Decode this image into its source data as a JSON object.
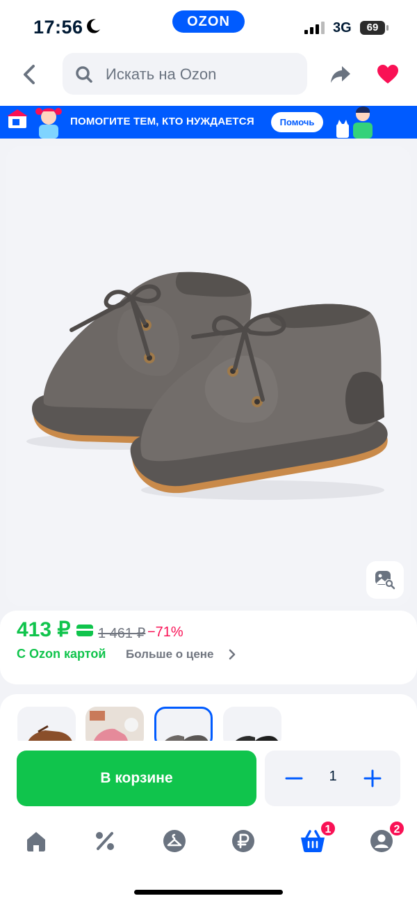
{
  "status_bar": {
    "time": "17:56",
    "brand": "OZON",
    "network": "3G",
    "battery": "69"
  },
  "search": {
    "placeholder": "Искать на Ozon",
    "icons": [
      "back-arrow-icon",
      "search-icon",
      "share-icon",
      "heart-icon"
    ]
  },
  "banner": {
    "text": "ПОМОГИТЕ ТЕМ, КТО НУЖДАЕТСЯ",
    "button": "Помочь"
  },
  "product": {
    "image_alt": "grey suede baby shoes",
    "photo_search_icon": "photo-search-icon"
  },
  "price": {
    "current": "413 ₽",
    "old": "1 461 ₽",
    "discount": "−71%",
    "card_label": "С Ozon картой",
    "more_label": "Больше о цене"
  },
  "variants": {
    "count": 4,
    "selected_index": 2
  },
  "buy": {
    "cart_label": "В корзине",
    "quantity": "1"
  },
  "tabbar": {
    "tabs": [
      {
        "name": "home",
        "icon": "home-icon"
      },
      {
        "name": "promo",
        "icon": "percent-icon"
      },
      {
        "name": "fresh",
        "icon": "hanger-icon"
      },
      {
        "name": "finance",
        "icon": "ruble-icon"
      },
      {
        "name": "cart",
        "icon": "basket-icon",
        "badge": "1"
      },
      {
        "name": "profile",
        "icon": "profile-icon",
        "badge": "2"
      }
    ]
  },
  "colors": {
    "brand_blue": "#005bff",
    "green": "#10c44c",
    "pink": "#f91155",
    "muted": "#70757f"
  }
}
